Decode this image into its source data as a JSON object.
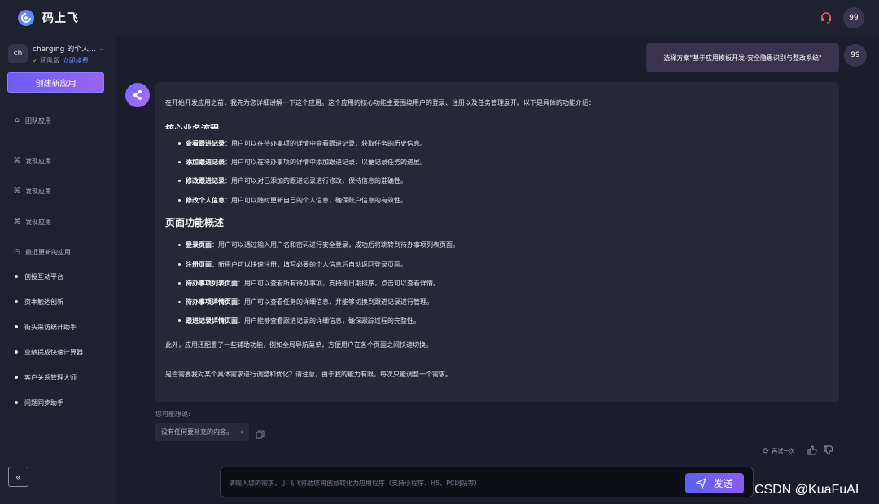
{
  "app": {
    "name": "码上飞",
    "user_avatar_text": "99"
  },
  "sidebar": {
    "team": {
      "avatar_text": "ch",
      "name": "charging 的个人...",
      "plan": "团队版",
      "renew_label": "立即续费"
    },
    "create_label": "创建新应用",
    "nav": [
      {
        "label": "团队应用",
        "icon": "home-icon"
      },
      {
        "label": "发现应用",
        "icon": "command-icon"
      },
      {
        "label": "发现应用",
        "icon": "command-icon"
      },
      {
        "label": "发现应用",
        "icon": "command-icon"
      },
      {
        "label": "最近更新的应用",
        "icon": "clock-icon"
      }
    ],
    "recent": [
      "创投互动平台",
      "资本触达创新",
      "街头采访统计助手",
      "业绩提成快速计算器",
      "客户关系管理大师",
      "问题同步助手"
    ]
  },
  "chat": {
    "user_message": "选择方案\"基于应用模板开发-安全隐患识别与整改系统\"",
    "answer": {
      "intro": "在开始开发应用之前，我先为您详细讲解一下这个应用。这个应用的核心功能主要围绕用户的登录、注册以及任务管理展开。以下是具体的功能介绍：",
      "cut_heading": "核心业务流程",
      "business": [
        {
          "title": "查看跟进记录",
          "desc": "：用户可以在待办事项的详情中查看跟进记录，获取任务的历史信息。"
        },
        {
          "title": "添加跟进记录",
          "desc": "：用户可以在待办事项的详情中添加跟进记录，以便记录任务的进展。"
        },
        {
          "title": "修改跟进记录",
          "desc": "：用户可以对已添加的跟进记录进行修改，保持信息的准确性。"
        },
        {
          "title": "修改个人信息",
          "desc": "：用户可以随时更新自己的个人信息，确保账户信息的有效性。"
        }
      ],
      "pages_heading": "页面功能概述",
      "pages": [
        {
          "title": "登录页面",
          "desc": "：用户可以通过输入用户名和密码进行安全登录，成功后将跳转到待办事项列表页面。"
        },
        {
          "title": "注册页面",
          "desc": "：新用户可以快速注册，填写必要的个人信息后自动返回登录页面。"
        },
        {
          "title": "待办事项列表页面",
          "desc": "：用户可以查看所有待办事项，支持按日期排序，点击可以查看详情。"
        },
        {
          "title": "待办事项详情页面",
          "desc": "：用户可以查看任务的详细信息，并能够切换到跟进记录进行管理。"
        },
        {
          "title": "跟进记录详情页面",
          "desc": "：用户能够查看跟进记录的详细信息，确保跟踪过程的完整性。"
        }
      ],
      "extra": "此外，应用还配置了一些辅助功能，例如全局导航菜单，方便用户在各个页面之间快速切换。",
      "question": "是否需要我对某个具体需求进行调整和优化？请注意，由于我的能力有限，每次只能调整一个需求。"
    },
    "suggest_label": "您可能想说:",
    "suggest_chip": "没有任何要补充的内容。",
    "retry_label": "再试一次"
  },
  "input": {
    "placeholder": "请输入您的需求，小飞飞将助您将创意转化为应用程序（支持小程序、H5、PC网站等）",
    "send_label": "发送"
  },
  "watermark": "CSDN @KuaFuAI",
  "colors": {
    "accent": "#6b5cf5",
    "background": "#1b1d2c",
    "panel": "#262838"
  }
}
